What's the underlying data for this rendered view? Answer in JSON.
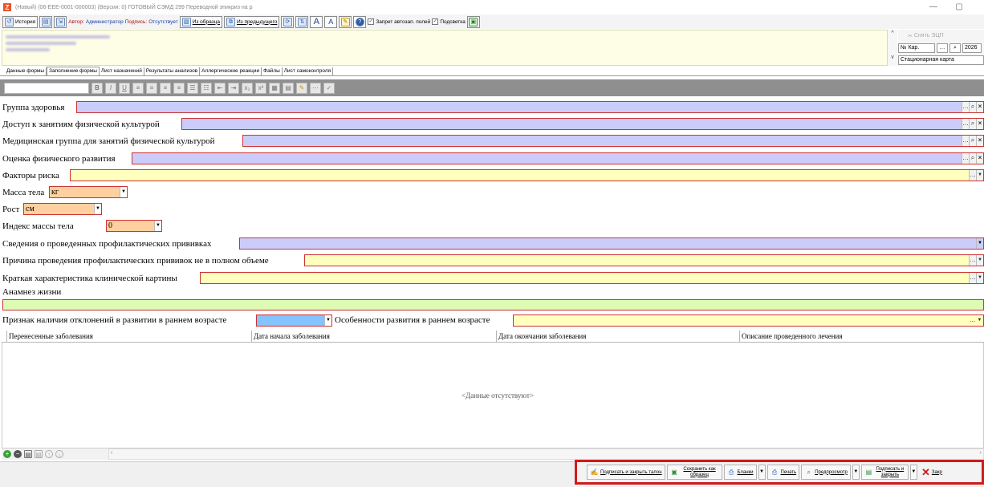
{
  "window": {
    "title": "(Новый) (06-EEE-0001-000003) (Версия: 0) ГОТОВЫЙ СЭМД 299 Переводной эпикриз на р",
    "minimize": "—",
    "restore": "▢"
  },
  "toolbar": {
    "history": "История",
    "author_label": "Автор:",
    "author_value": "Администратор",
    "sign_label": "Подпись:",
    "sign_value": "Отсутствует",
    "from_template": "Из образца",
    "from_previous": "Из предыдущего",
    "autofill_lock": "Запрет автозап. полей",
    "highlight": "Подсветка"
  },
  "right_panel": {
    "sign_ecp": "Снять ЭЦП",
    "card_number_label": "№ Кар.",
    "year": "2026",
    "card_type": "Стационарная карта"
  },
  "tabs": [
    {
      "label": "Данные формы"
    },
    {
      "label": "Заполнение формы"
    },
    {
      "label": "Лист назначений"
    },
    {
      "label": "Результаты анализов"
    },
    {
      "label": "Аллергические реакции"
    },
    {
      "label": "Файлы"
    },
    {
      "label": "Лист самоконтроля"
    }
  ],
  "form": {
    "health_group": "Группа здоровья",
    "pe_access": "Доступ к занятиям физической культурой",
    "pe_medical_group": "Медицинская группа для занятий физической культурой",
    "physical_dev": "Оценка физического развития",
    "risk_factors": "Факторы риска",
    "body_mass": "Масса тела",
    "body_mass_unit": "кг",
    "height": "Рост",
    "height_unit": "см",
    "bmi": "Индекс массы тела",
    "bmi_value": "0",
    "vaccinations": "Сведения о проведенных профилактических прививках",
    "vacc_reason": "Причина проведения профилактических прививок не в полном объеме",
    "clinical_summary": "Краткая характеристика клинической картины",
    "life_anamnesis": "Анамнез жизни",
    "dev_deviation": "Признак наличия отклонений в развитии в раннем возрасте",
    "dev_features": "Особенности развития в раннем возрасте"
  },
  "grid": {
    "columns": [
      "Перенесенные заболевания",
      "Дата начала заболевания",
      "Дата окончания заболевания",
      "Описание проведенного лечения"
    ],
    "empty_text": "<Данные отсутствуют>"
  },
  "actions": {
    "sign_close_ticket": "Подписать и закрыть талон",
    "save_as_template": "Сохранить как образец",
    "forms": "Бланки",
    "print": "Печать",
    "preview": "Предпросмотр",
    "sign_and_close": "Подписать и закрыть",
    "close": "Закр"
  },
  "colors": {
    "lavender_field": "#ccccfa",
    "yellow_field": "#ffffbe",
    "orange_field": "#fecf9f",
    "green_field": "#ddfbb2",
    "blue_field": "#82c4ff",
    "highlight_border": "#d11a1a"
  }
}
